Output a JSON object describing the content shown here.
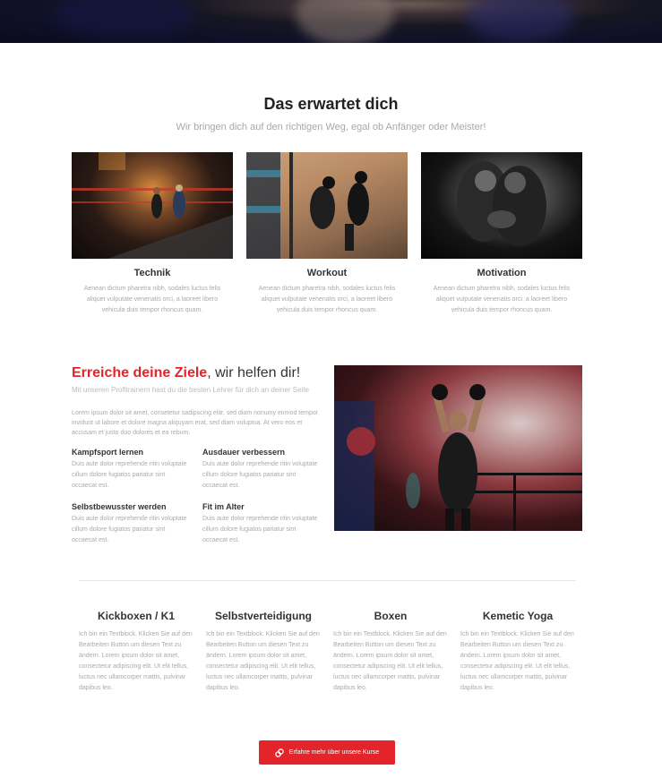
{
  "section": {
    "title": "Das erwartet dich",
    "subtitle": "Wir bringen dich auf den richtigen Weg, egal ob Anfänger oder Meister!"
  },
  "cards": [
    {
      "title": "Technik",
      "text": "Aenean dictum pharetra nibh, sodales luctus felis aliquet vulputate venenatis orci, a laoreet libero vehicula duis tempor rhoncus quam."
    },
    {
      "title": "Workout",
      "text": "Aenean dictum pharetra nibh, sodales luctus felis aliquet vulputate venenatis orci, a laoreet libero vehicula duis tempor rhoncus quam."
    },
    {
      "title": "Motivation",
      "text": "Aenean dictum pharetra nibh, sodales luctus felis aliquet vulputate venenatis orci, a laoreet libero vehicula duis tempor rhoncus quam."
    }
  ],
  "goals": {
    "heading_red": "Erreiche deine Ziele",
    "heading_rest": ", wir helfen dir!",
    "subheading": "Mit unseren Profitrainern hast du die besten Lehrer für dich an deiner Seite",
    "paragraph": "Lorem ipsum dolor sit amet, consetetur sadipscing elitr, sed diam nonumy eirmod tempor invidunt ut labore et dolore magna aliquyam erat, sed diam voluptua. At vero eos et accusam et justo duo dolores et ea rebum.",
    "features": [
      {
        "title": "Kampfsport lernen",
        "text": "Duis aute dolor reprehende ritin voluptate cillum dolore fugiatos pariatur sint occaecat est."
      },
      {
        "title": "Ausdauer verbessern",
        "text": "Duis aute dolor reprehende ritin voluptate cillum dolore fugiatos pariatur sint occaecat est."
      },
      {
        "title": "Selbstbewusster werden",
        "text": "Duis aute dolor reprehende ritin voluptate cillum dolore fugiatos pariatur sint occaecat est."
      },
      {
        "title": "Fit im Alter",
        "text": "Duis aute dolor reprehende ritin voluptate cillum dolore fugiatos pariatur sint occaecat est."
      }
    ]
  },
  "courses": [
    {
      "title": "Kickboxen / K1",
      "text": "Ich bin ein Textblock. Klicken Sie auf den Bearbeiten Button um diesen Text zu ändern. Lorem ipsum dolor sit amet, consectetur adipiscing elit. Ut elit tellus, luctus nec ullamcorper mattis, pulvinar dapibus leo."
    },
    {
      "title": "Selbstverteidigung",
      "text": "Ich bin ein Textblock. Klicken Sie auf den Bearbeiten Button um diesen Text zu ändern. Lorem ipsum dolor sit amet, consectetur adipiscing elit. Ut elit tellus, luctus nec ullamcorper mattis, pulvinar dapibus leo."
    },
    {
      "title": "Boxen",
      "text": "Ich bin ein Textblock. Klicken Sie auf den Bearbeiten Button um diesen Text zu ändern. Lorem ipsum dolor sit amet, consectetur adipiscing elit. Ut elit tellus, luctus nec ullamcorper mattis, pulvinar dapibus leo."
    },
    {
      "title": "Kemetic Yoga",
      "text": "Ich bin ein Textblock. Klicken Sie auf den Bearbeiten Button um diesen Text zu ändern. Lorem ipsum dolor sit amet, consectetur adipiscing elit. Ut elit tellus, luctus nec ullamcorper mattis, pulvinar dapibus leo."
    }
  ],
  "cta": {
    "label": "Erfahre mehr über unsere Kurse",
    "icon": "link-icon"
  },
  "colors": {
    "accent": "#e3252b",
    "heading": "#222222",
    "muted": "#aaaaaa"
  }
}
